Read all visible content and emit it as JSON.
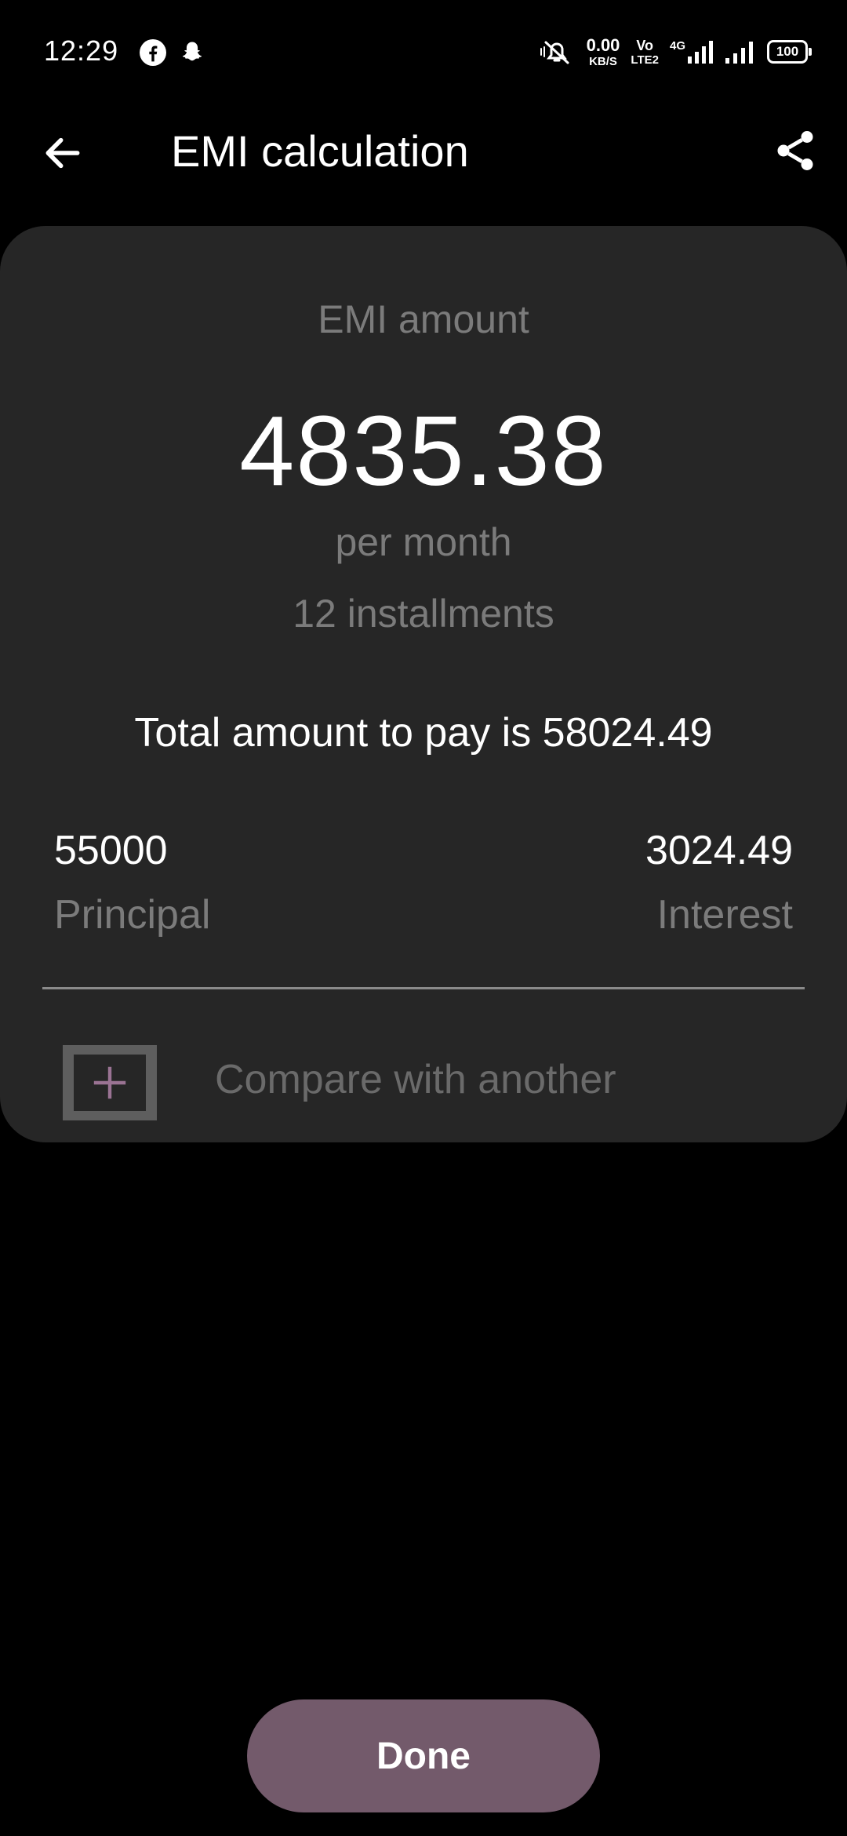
{
  "status_bar": {
    "time": "12:29",
    "net_speed_value": "0.00",
    "net_speed_unit": "KB/S",
    "volte_top": "Vo",
    "volte_bottom": "LTE2",
    "network_type": "4G",
    "battery": "100",
    "icons": [
      "facebook-icon",
      "snapchat-icon",
      "mute-icon",
      "signal-icon",
      "signal-icon",
      "battery-icon"
    ]
  },
  "app_bar": {
    "title": "EMI calculation",
    "back_icon": "arrow-left-icon",
    "share_icon": "share-icon"
  },
  "card": {
    "emi_label": "EMI amount",
    "emi_value": "4835.38",
    "per_month": "per month",
    "installments": "12 installments",
    "total_line": "Total amount to pay is 58024.49",
    "principal_value": "55000",
    "principal_label": "Principal",
    "interest_value": "3024.49",
    "interest_label": "Interest",
    "compare_label": "Compare with another",
    "compare_icon": "plus-icon"
  },
  "actions": {
    "done_label": "Done"
  },
  "colors": {
    "background": "#000000",
    "card": "#262626",
    "muted_text": "#7b7b7b",
    "accent": "#735a6b",
    "plus_icon": "#9a7393"
  }
}
